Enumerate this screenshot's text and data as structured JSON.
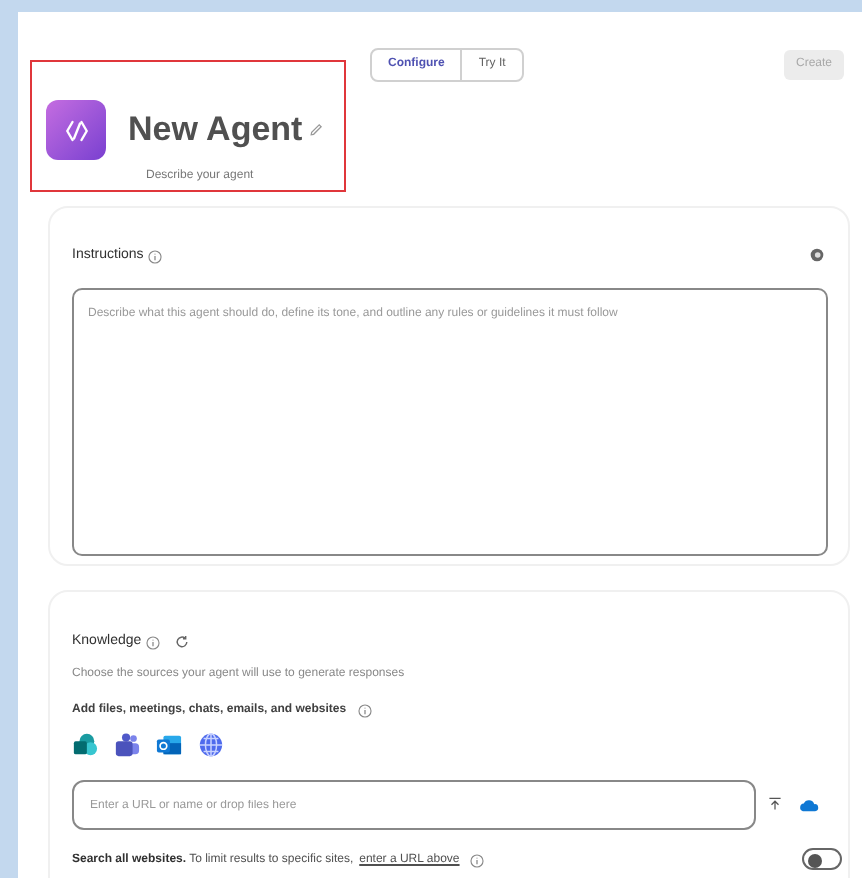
{
  "tabs": [
    {
      "label": "Configure",
      "selected": true
    },
    {
      "label": "Try It",
      "selected": false
    }
  ],
  "create_button": {
    "label": "Create",
    "disabled": true
  },
  "agent": {
    "name": "New Agent",
    "description": "Describe your agent"
  },
  "instructions": {
    "title": "Instructions",
    "placeholder": "Describe what this agent should do, define its tone, and outline any rules or guidelines it must follow"
  },
  "knowledge": {
    "title": "Knowledge",
    "subtitle": "Choose the sources your agent will use to generate responses",
    "add_label": "Add files, meetings, chats, emails, and websites",
    "sources": [
      {
        "kind": "sharepoint"
      },
      {
        "kind": "teams"
      },
      {
        "kind": "outlook"
      },
      {
        "kind": "web"
      }
    ],
    "url_placeholder": "Enter a URL or name or drop files here",
    "search_all": {
      "text": "**Search all websites.** To limit results to specific sites,",
      "link": "enter a URL above",
      "on": false
    }
  }
}
